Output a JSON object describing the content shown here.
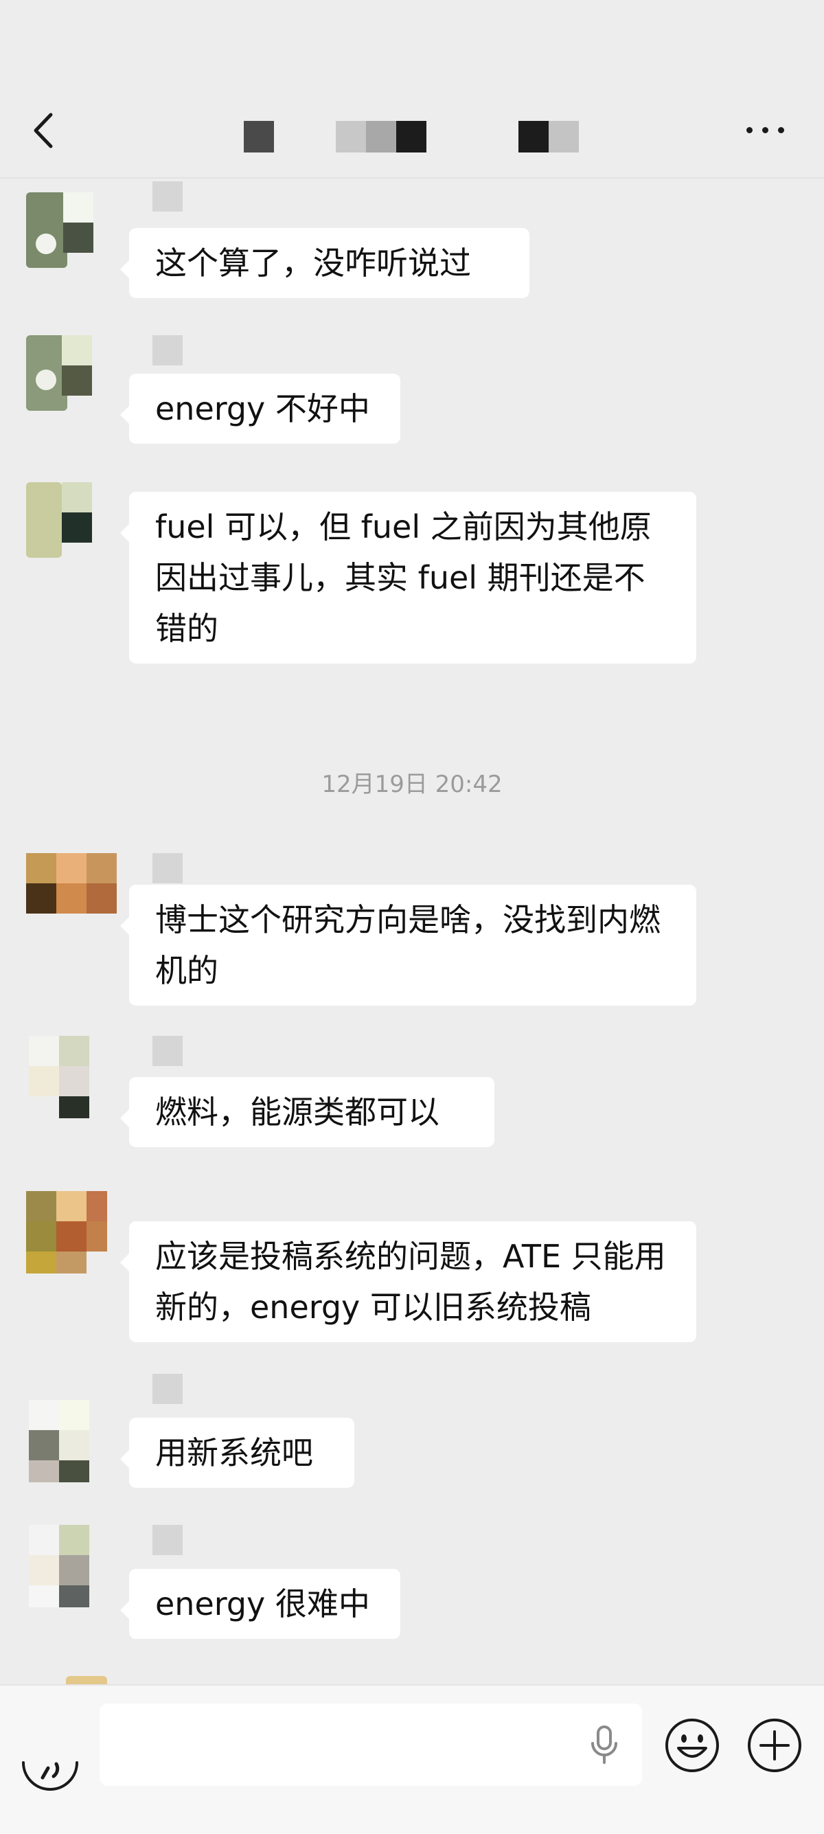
{
  "header": {
    "back_icon": "chevron-left-icon",
    "title_redacted": true,
    "more_icon": "more-dots-icon"
  },
  "messages": [
    {
      "text": "这个算了，没咋听说过"
    },
    {
      "text": "energy 不好中"
    },
    {
      "text": "fuel 可以，但 fuel 之前因为其他原因出过事儿，其实 fuel 期刊还是不错的"
    },
    {
      "text": "博士这个研究方向是啥，没找到内燃机的"
    },
    {
      "text": "燃料，能源类都可以"
    },
    {
      "text": "应该是投稿系统的问题，ATE 只能用新的，energy 可以旧系统投稿"
    },
    {
      "text": "用新系统吧"
    },
    {
      "text": "energy 很难中"
    }
  ],
  "timestamp": "12月19日 20:42",
  "input_bar": {
    "voice_icon": "voice-toggle-icon",
    "mic_icon": "microphone-icon",
    "emoji_icon": "emoji-icon",
    "plus_icon": "plus-circle-icon"
  }
}
